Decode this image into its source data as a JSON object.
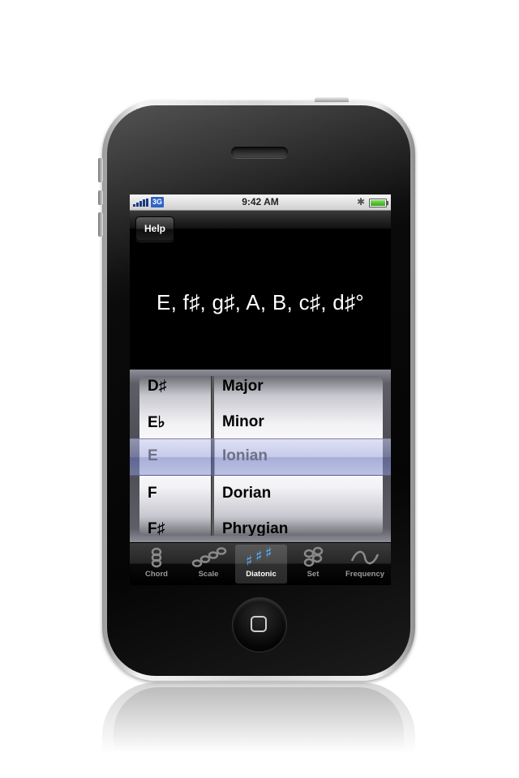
{
  "status_bar": {
    "network": "3G",
    "time": "9:42 AM"
  },
  "nav": {
    "help_label": "Help"
  },
  "scale_display": "E, f♯, g♯, A, B, c♯, d♯°",
  "picker": {
    "root_notes": [
      "D♯",
      "E♭",
      "E",
      "F",
      "F♯"
    ],
    "modes": [
      "Major",
      "Minor",
      "Ionian",
      "Dorian",
      "Phrygian"
    ],
    "selected_root": "E",
    "selected_mode": "Ionian"
  },
  "tab_bar": {
    "tabs": [
      {
        "label": "Chord",
        "icon": "chord-icon"
      },
      {
        "label": "Scale",
        "icon": "scale-icon"
      },
      {
        "label": "Diatonic",
        "icon": "diatonic-icon"
      },
      {
        "label": "Set",
        "icon": "set-icon"
      },
      {
        "label": "Frequency",
        "icon": "frequency-icon"
      }
    ],
    "active_tab": "Diatonic"
  },
  "colors": {
    "selection_highlight": "#8c96d2",
    "active_tab_icon": "#5ab4ff"
  }
}
